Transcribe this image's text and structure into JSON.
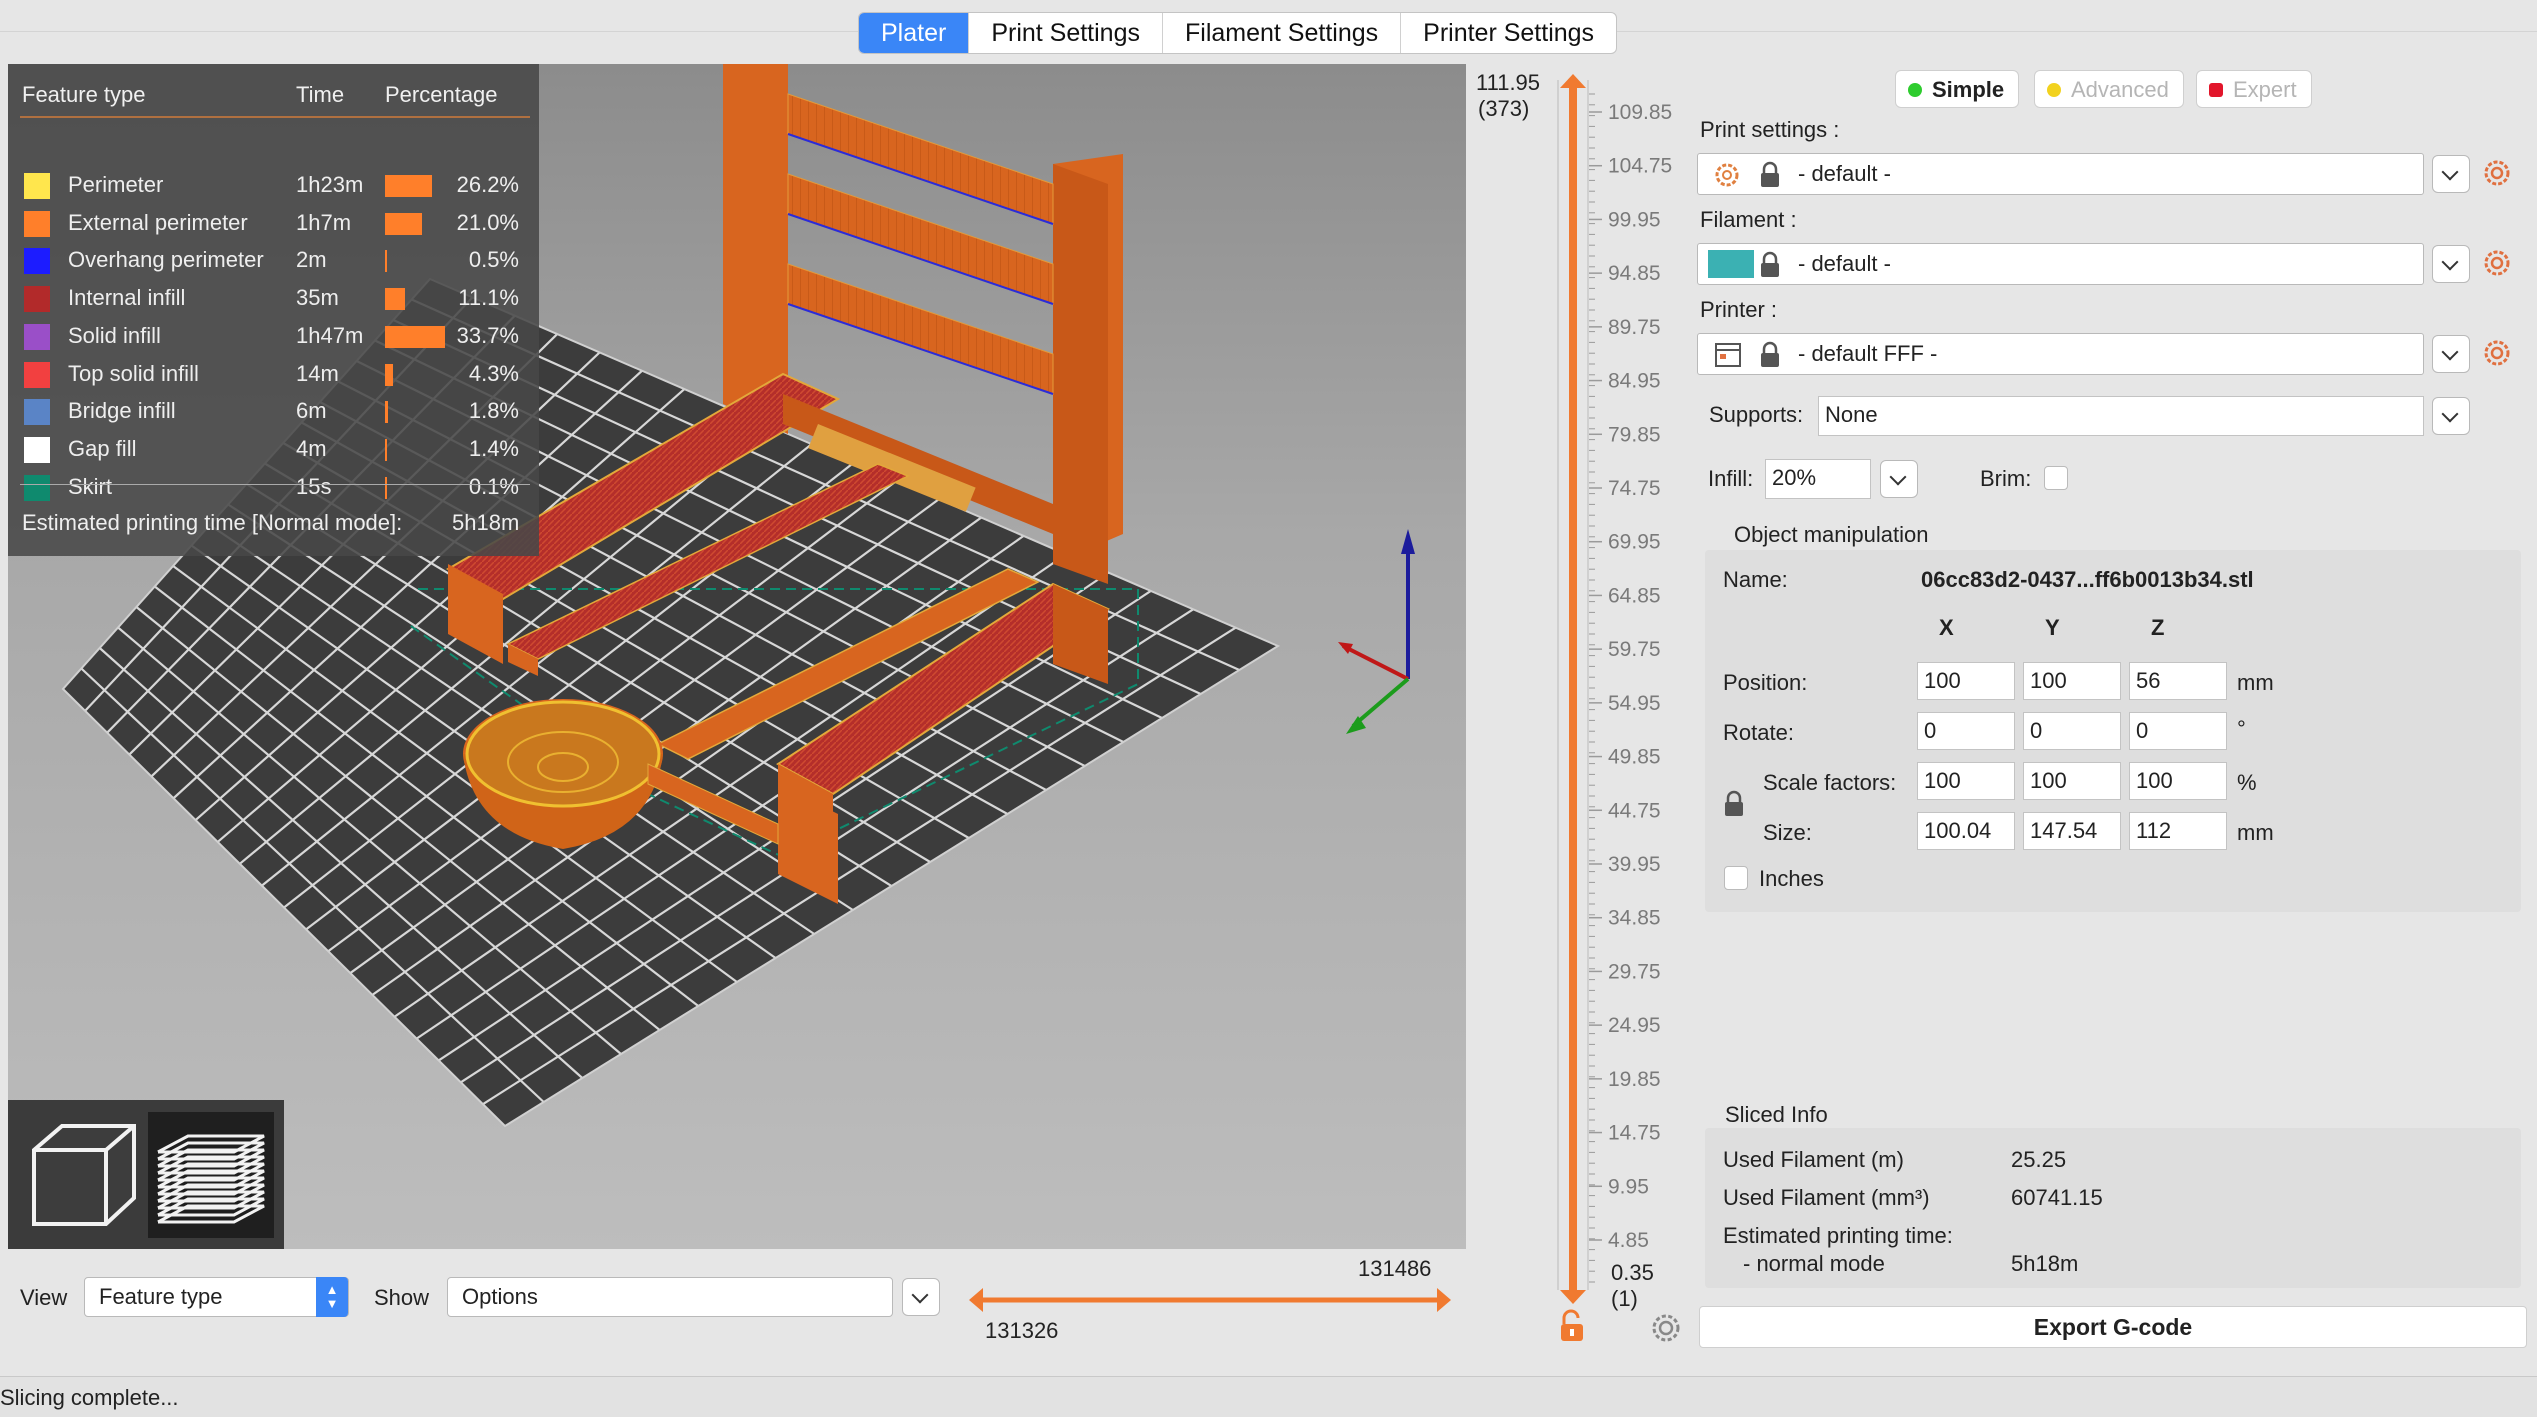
{
  "tabs": [
    "Plater",
    "Print Settings",
    "Filament Settings",
    "Printer Settings"
  ],
  "legend": {
    "headers": {
      "feature": "Feature type",
      "time": "Time",
      "percentage": "Percentage"
    },
    "rows": [
      {
        "name": "Perimeter",
        "time": "1h23m",
        "pct": "26.2%",
        "color": "#ffe64d",
        "value": 26.2
      },
      {
        "name": "External perimeter",
        "time": "1h7m",
        "pct": "21.0%",
        "color": "#ff7f2a",
        "value": 21.0
      },
      {
        "name": "Overhang perimeter",
        "time": "2m",
        "pct": "0.5%",
        "color": "#1c1cff",
        "value": 0.5
      },
      {
        "name": "Internal infill",
        "time": "35m",
        "pct": "11.1%",
        "color": "#b22a2a",
        "value": 11.1
      },
      {
        "name": "Solid infill",
        "time": "1h47m",
        "pct": "33.7%",
        "color": "#9a4fc8",
        "value": 33.7
      },
      {
        "name": "Top solid infill",
        "time": "14m",
        "pct": "4.3%",
        "color": "#f24040",
        "value": 4.3
      },
      {
        "name": "Bridge infill",
        "time": "6m",
        "pct": "1.8%",
        "color": "#5a84c6",
        "value": 1.8
      },
      {
        "name": "Gap fill",
        "time": "4m",
        "pct": "1.4%",
        "color": "#ffffff",
        "value": 1.4
      },
      {
        "name": "Skirt",
        "time": "15s",
        "pct": "0.1%",
        "color": "#0f8a6e",
        "value": 0.1
      }
    ],
    "estimated_label": "Estimated printing time [Normal mode]:",
    "estimated_value": "5h18m"
  },
  "bottom": {
    "view_label": "View",
    "view_value": "Feature type",
    "show_label": "Show",
    "show_value": "Options",
    "h_slider_right": "131486",
    "h_slider_left": "131326"
  },
  "vslider": {
    "top_value": "111.95",
    "top_layer": "(373)",
    "bottom_value": "0.35",
    "bottom_layer": "(1)",
    "ticks": [
      "109.85",
      "104.75",
      "99.95",
      "94.85",
      "89.75",
      "84.95",
      "79.85",
      "74.75",
      "69.95",
      "64.85",
      "59.75",
      "54.95",
      "49.85",
      "44.75",
      "39.95",
      "34.85",
      "29.75",
      "24.95",
      "19.85",
      "14.75",
      "9.95",
      "4.85"
    ]
  },
  "modes": {
    "simple": "Simple",
    "advanced": "Advanced",
    "expert": "Expert"
  },
  "print_settings": {
    "label": "Print settings :",
    "value": "- default -"
  },
  "filament": {
    "label": "Filament :",
    "value": "- default -",
    "color": "#3bb1b3"
  },
  "printer": {
    "label": "Printer :",
    "value": "- default FFF -"
  },
  "supports": {
    "label": "Supports:",
    "value": "None"
  },
  "infill": {
    "label": "Infill:",
    "value": "20%"
  },
  "brim": {
    "label": "Brim:"
  },
  "object_manipulation": {
    "title": "Object manipulation",
    "name_label": "Name:",
    "name_value": "06cc83d2-0437...ff6b0013b34.stl",
    "axes": [
      "X",
      "Y",
      "Z"
    ],
    "position": {
      "label": "Position:",
      "x": "100",
      "y": "100",
      "z": "56",
      "unit": "mm"
    },
    "rotate": {
      "label": "Rotate:",
      "x": "0",
      "y": "0",
      "z": "0",
      "unit": "°"
    },
    "scale": {
      "label": "Scale factors:",
      "x": "100",
      "y": "100",
      "z": "100",
      "unit": "%"
    },
    "size": {
      "label": "Size:",
      "x": "100.04",
      "y": "147.54",
      "z": "112",
      "unit": "mm"
    },
    "inches_label": "Inches"
  },
  "sliced_info": {
    "title": "Sliced Info",
    "used_filament_m_label": "Used Filament (m)",
    "used_filament_m": "25.25",
    "used_filament_mm3_label": "Used Filament (mm³)",
    "used_filament_mm3": "60741.15",
    "est_label": "Estimated printing time:",
    "normal_mode_label": "- normal mode",
    "normal_mode_value": "5h18m"
  },
  "export_label": "Export G-code",
  "status": "Slicing complete..."
}
